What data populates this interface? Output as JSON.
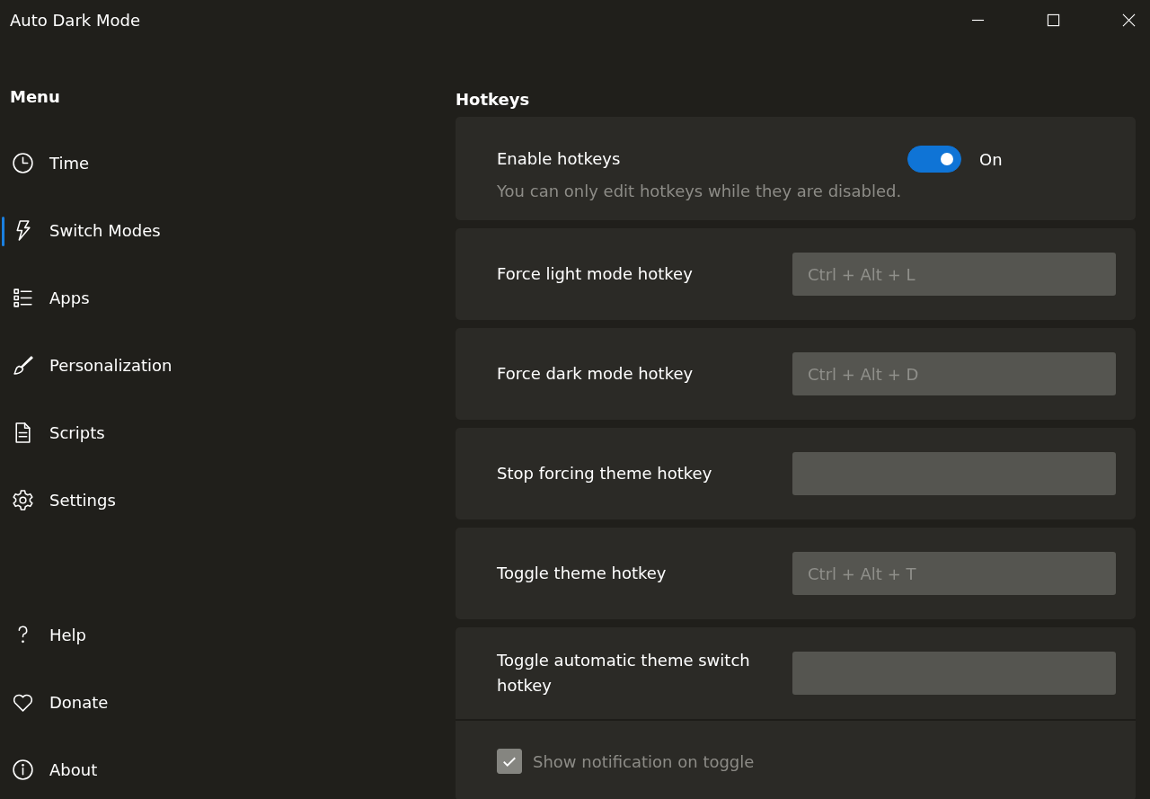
{
  "window": {
    "title": "Auto Dark Mode"
  },
  "sidebar": {
    "heading": "Menu",
    "items": [
      {
        "label": "Time",
        "selected": false
      },
      {
        "label": "Switch Modes",
        "selected": true
      },
      {
        "label": "Apps",
        "selected": false
      },
      {
        "label": "Personalization",
        "selected": false
      },
      {
        "label": "Scripts",
        "selected": false
      },
      {
        "label": "Settings",
        "selected": false
      }
    ],
    "footer_items": [
      {
        "label": "Help",
        "selected": false
      },
      {
        "label": "Donate",
        "selected": false
      },
      {
        "label": "About",
        "selected": false
      }
    ]
  },
  "section": {
    "title": "Hotkeys",
    "enable": {
      "label": "Enable hotkeys",
      "on": true,
      "state_label": "On",
      "note": "You can only edit hotkeys while they are disabled."
    },
    "hotkeys": [
      {
        "label": "Force light mode hotkey",
        "value": "Ctrl + Alt + L",
        "disabled": true
      },
      {
        "label": "Force dark mode hotkey",
        "value": "Ctrl + Alt + D",
        "disabled": true
      },
      {
        "label": "Stop forcing theme hotkey",
        "disabled": true
      },
      {
        "label": "Toggle theme hotkey",
        "value": "Ctrl + Alt + T",
        "disabled": true
      },
      {
        "label": "Toggle automatic theme switch hotkey",
        "disabled": true
      }
    ],
    "notification": {
      "label": "Show notification on toggle",
      "checked": true,
      "disabled": true
    }
  }
}
